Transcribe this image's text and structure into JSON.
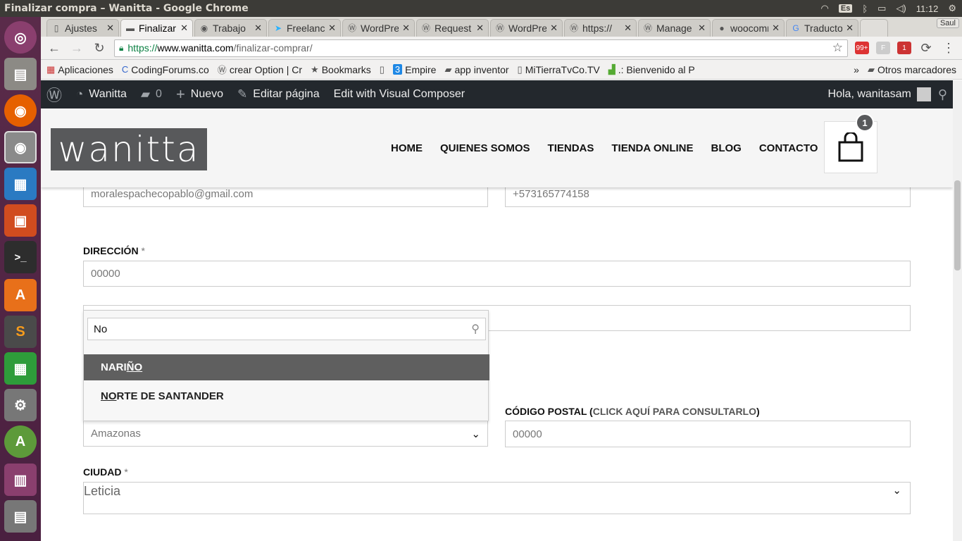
{
  "os": {
    "window_title": "Finalizar compra – Wanitta - Google Chrome",
    "keyboard_lang": "Es",
    "clock": "11:12"
  },
  "launcher": {
    "items": [
      "Ubuntu Dash",
      "Files",
      "Firefox",
      "Chrome",
      "LibreOffice Writer",
      "LibreOffice Impress",
      "Terminal",
      "Ubuntu Software",
      "Sublime Text",
      "LibreOffice Calc",
      "System Settings",
      "Android Studio",
      "Workspace Switcher",
      "Trash"
    ]
  },
  "browser": {
    "tabs": [
      {
        "label": "Ajustes",
        "icon": "page-icon"
      },
      {
        "label": "Finalizar",
        "icon": "wanitta-icon",
        "active": true
      },
      {
        "label": "Trabajo",
        "icon": "chrome-icon"
      },
      {
        "label": "Freelancer",
        "icon": "freelancer-icon"
      },
      {
        "label": "WordPress",
        "icon": "wordpress-icon"
      },
      {
        "label": "Request",
        "icon": "wordpress-icon"
      },
      {
        "label": "WordPress",
        "icon": "wordpress-icon"
      },
      {
        "label": "https://",
        "icon": "wordpress-icon"
      },
      {
        "label": "Manage",
        "icon": "wordpress-icon"
      },
      {
        "label": "woocommerce",
        "icon": "github-icon"
      },
      {
        "label": "Traductor",
        "icon": "translate-icon"
      }
    ],
    "profile_name": "Saul",
    "url": {
      "scheme": "https://",
      "host": "www.wanitta.com",
      "path": "/finalizar-comprar/"
    },
    "extension_badges": [
      "99+",
      "",
      "1"
    ],
    "bookmarks": [
      {
        "label": "Aplicaciones",
        "icon": "apps-icon"
      },
      {
        "label": "CodingForums.co",
        "icon": "codingforums-icon"
      },
      {
        "label": "crear Option | Cr",
        "icon": "wordpress-icon"
      },
      {
        "label": "Bookmarks",
        "icon": "star-icon"
      },
      {
        "label": "",
        "icon": "page-icon"
      },
      {
        "label": "Empire",
        "icon": "empire-icon"
      },
      {
        "label": "app inventor",
        "icon": "folder-icon"
      },
      {
        "label": "MiTierraTvCo.TV",
        "icon": "page-icon"
      },
      {
        "label": ".: Bienvenido al P",
        "icon": "bienvenido-icon"
      }
    ],
    "bookmarks_overflow": "»",
    "other_bookmarks": "Otros marcadores"
  },
  "wp_admin_bar": {
    "site_name": "Wanitta",
    "comments_count": "0",
    "new_label": "Nuevo",
    "edit_page_label": "Editar página",
    "visual_composer_label": "Edit with Visual Composer",
    "greeting": "Hola, wanitasam"
  },
  "site": {
    "logo_text": "wanitta",
    "nav": [
      "HOME",
      "QUIENES SOMOS",
      "TIENDAS",
      "TIENDA ONLINE",
      "BLOG",
      "CONTACTO"
    ],
    "cart_count": "1"
  },
  "form": {
    "email_value": "moralespachecopablo@gmail.com",
    "phone_value": "+573165774158",
    "address_label": "DIRECCIÓN",
    "required_mark": "*",
    "address_value": "00000",
    "address2_value": "",
    "department_value": "Amazonas",
    "postal_label": "CÓDIGO POSTAL (",
    "postal_link": "CLICK AQUÍ PARA CONSULTARLO",
    "postal_label_end": ")",
    "postal_value": "00000",
    "city_label": "CIUDAD",
    "city_value": "Leticia"
  },
  "dropdown": {
    "search_value": "No",
    "options": [
      {
        "match": "",
        "pre": "NARI",
        "m": "ÑO",
        "post": "",
        "highlighted": true
      },
      {
        "match": "",
        "pre": "",
        "m": "NO",
        "post": "RTE DE SANTANDER",
        "highlighted": false
      }
    ]
  }
}
